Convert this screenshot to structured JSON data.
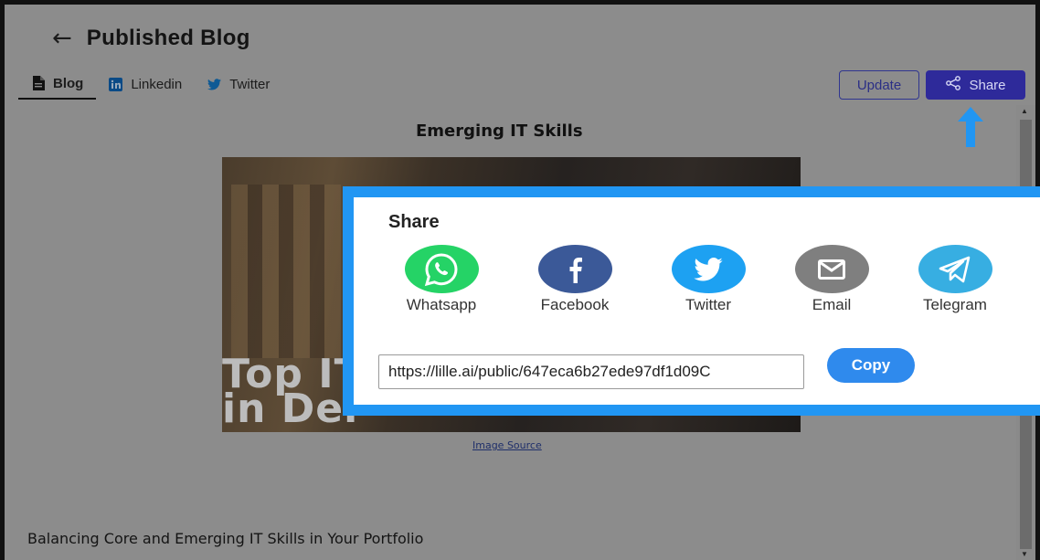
{
  "header": {
    "back_icon": "left-arrow-icon",
    "title": "Published Blog"
  },
  "tabs": [
    {
      "label": "Blog",
      "icon": "document-icon",
      "active": true
    },
    {
      "label": "Linkedin",
      "icon": "linkedin-icon",
      "active": false
    },
    {
      "label": "Twitter",
      "icon": "twitter-icon",
      "active": false
    }
  ],
  "actions": {
    "update_label": "Update",
    "share_label": "Share",
    "share_icon": "share-icon"
  },
  "blog": {
    "title": "Emerging IT Skills",
    "image_overlay_line1": "Top IT",
    "image_overlay_line2": "in Der",
    "image_source": "Image Source",
    "subtitle": "Balancing Core and Emerging IT Skills in Your Portfolio"
  },
  "share_modal": {
    "title": "Share",
    "options": [
      {
        "label": "Whatsapp",
        "icon": "whatsapp-icon",
        "color": "#25d366"
      },
      {
        "label": "Facebook",
        "icon": "facebook-icon",
        "color": "#3b5998"
      },
      {
        "label": "Twitter",
        "icon": "twitter-icon",
        "color": "#1da1f2"
      },
      {
        "label": "Email",
        "icon": "email-icon",
        "color": "#7f7f7f"
      },
      {
        "label": "Telegram",
        "icon": "telegram-icon",
        "color": "#37aee2"
      }
    ],
    "link_value": "https://lille.ai/public/647eca6b27ede97df1d09C",
    "copy_label": "Copy"
  },
  "colors": {
    "highlight_border": "#2196f3",
    "share_button": "#2e2a9a",
    "overlay": "#8c8c8c"
  }
}
